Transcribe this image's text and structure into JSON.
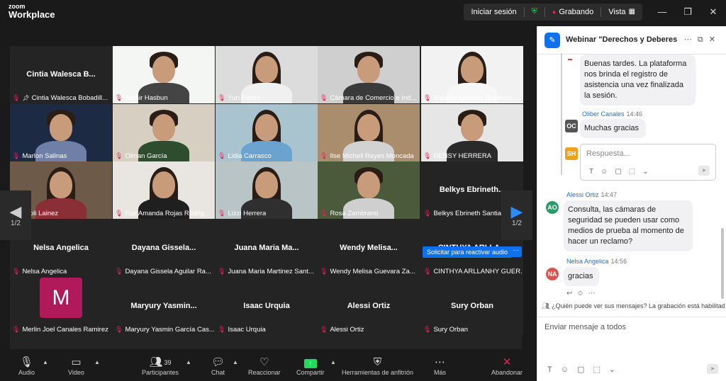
{
  "app": {
    "brand_small": "zoom",
    "brand_large": "Workplace"
  },
  "topbar": {
    "signin": "Iniciar sesión",
    "recording": "Grabando",
    "view": "Vista"
  },
  "grid": {
    "page_left": "1/2",
    "page_right": "1/2",
    "reactivate_audio": "Solicitar para reactivar audio",
    "tiles": [
      {
        "label": "Cintia Walesca Bobadill...",
        "big": "Cintia Walesca B..."
      },
      {
        "label": "Samir Hasbun",
        "big": ""
      },
      {
        "label": "Yuri Flores",
        "big": ""
      },
      {
        "label": "Cámara de Comercio e Ind...",
        "big": ""
      },
      {
        "label": "Mabelin Ninoska Gutiérrez...",
        "big": ""
      },
      {
        "label": "Marlon Salinas",
        "big": ""
      },
      {
        "label": "Olman García",
        "big": ""
      },
      {
        "label": "Lidia Carrasco",
        "big": ""
      },
      {
        "label": "Ilse Michell Reyes Moncada",
        "big": ""
      },
      {
        "label": "DENSY HERRERA",
        "big": ""
      },
      {
        "label": "Leoli Lainez",
        "big": ""
      },
      {
        "label": "Flor Amanda Rojas Rodrig...",
        "big": ""
      },
      {
        "label": "Lizzi Herrera",
        "big": ""
      },
      {
        "label": "Rosa Zambrano",
        "big": ""
      },
      {
        "label": "Belkys Ebrineth Santiago V...",
        "big": "Belkys Ebrineth..."
      },
      {
        "label": "Nelsa Angelica",
        "big": "Nelsa Angelica"
      },
      {
        "label": "Dayana Gissela Aguilar Ra...",
        "big": "Dayana Gissela..."
      },
      {
        "label": "Juana Maria Martinez Sant...",
        "big": "Juana Maria Ma..."
      },
      {
        "label": "Wendy Melisa Guevara Za...",
        "big": "Wendy Melisa..."
      },
      {
        "label": "CINTHYA ARLLANHY GUER...",
        "big": "CINTHYA ARLLA..."
      },
      {
        "label": "Merlin Joel Canales Ramirez",
        "big": "",
        "avatar": "M"
      },
      {
        "label": "Maryury Yasmin García Cas...",
        "big": "Maryury Yasmin..."
      },
      {
        "label": "Isaac Urquia",
        "big": "Isaac Urquia"
      },
      {
        "label": "Alessi Ortiz",
        "big": "Alessi Ortiz"
      },
      {
        "label": "Sury Orban",
        "big": "Sury Orban"
      }
    ]
  },
  "toolbar": {
    "audio": "Audio",
    "video": "Video",
    "participants": "Participantes",
    "participants_count": "39",
    "chat": "Chat",
    "react": "Reaccionar",
    "share": "Compartir",
    "host_tools": "Herramientas de anfitrión",
    "more": "Más",
    "leave": "Abandonar"
  },
  "chat": {
    "title": "Webinar \"Derechos y Deberes d...",
    "messages": [
      {
        "text": "Buenas tardes. La plataforma nos brinda el registro de asistencia una vez finalizada la sesión."
      },
      {
        "sender": "Oliber Canales",
        "time": "14:46",
        "initials": "OC",
        "text": "Muchas gracias"
      },
      {
        "sender": "Alessi Ortiz",
        "time": "14:47",
        "initials": "AO",
        "text": "Consulta, las cámaras de seguridad se pueden usar como medios de prueba al momento de hacer un reclamo?"
      },
      {
        "sender": "Nelsa Angelica",
        "time": "14:56",
        "initials": "NA",
        "text": "gracias"
      }
    ],
    "reply_initials": "SH",
    "reply_placeholder": "Respuesta...",
    "visibility_note": "¿Quién puede ver sus mensajes? La grabación está habilitada",
    "input_placeholder": "Enviar mensaje a todos"
  },
  "colors": {
    "accent": "#0e72ed",
    "active_speaker": "#23d959",
    "muted": "#e0245e",
    "avatar_m": "#b01a5b"
  }
}
